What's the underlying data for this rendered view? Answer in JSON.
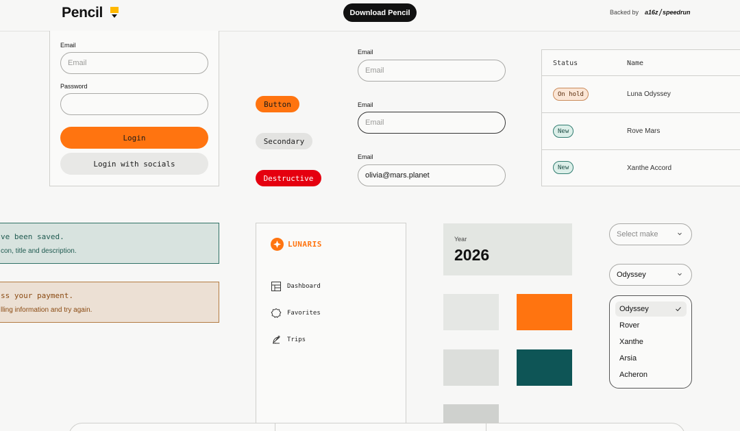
{
  "header": {
    "logo": "Pencil",
    "download_label": "Download Pencil",
    "backed_by": "Backed by",
    "backer": "a16z / speedrun"
  },
  "login": {
    "email_label": "Email",
    "email_placeholder": "Email",
    "password_label": "Password",
    "login_label": "Login",
    "socials_label": "Login with socials"
  },
  "buttons": {
    "primary": "Button",
    "secondary": "Secondary",
    "destructive": "Destructive"
  },
  "inputs": [
    {
      "label": "Email",
      "placeholder": "Email",
      "value": ""
    },
    {
      "label": "Email",
      "placeholder": "Email",
      "value": ""
    },
    {
      "label": "Email",
      "placeholder": "",
      "value": "olivia@mars.planet"
    }
  ],
  "table": {
    "headers": [
      "Status",
      "Name"
    ],
    "rows": [
      {
        "status": "On hold",
        "name": "Luna Odyssey"
      },
      {
        "status": "New",
        "name": "Rove Mars"
      },
      {
        "status": "New",
        "name": "Xanthe Accord"
      }
    ]
  },
  "alerts": {
    "success_title": "ve been saved.",
    "success_desc": "con, title and description.",
    "error_title": "ss your payment.",
    "error_desc": "lling information and try again."
  },
  "sidebar": {
    "brand": "LUNARIS",
    "items": [
      {
        "label": "Dashboard",
        "icon": "table-icon"
      },
      {
        "label": "Favorites",
        "icon": "badge-icon"
      },
      {
        "label": "Trips",
        "icon": "satellite-icon"
      }
    ]
  },
  "year": {
    "label": "Year",
    "value": "2026"
  },
  "selects": {
    "make_placeholder": "Select make",
    "model_value": "Odyssey",
    "options": [
      "Odyssey",
      "Rover",
      "Xanthe",
      "Arsia",
      "Acheron"
    ],
    "selected": "Odyssey"
  },
  "colors": {
    "accent": "#ff7410",
    "teal": "#0e5556",
    "destructive": "#e5000f"
  }
}
